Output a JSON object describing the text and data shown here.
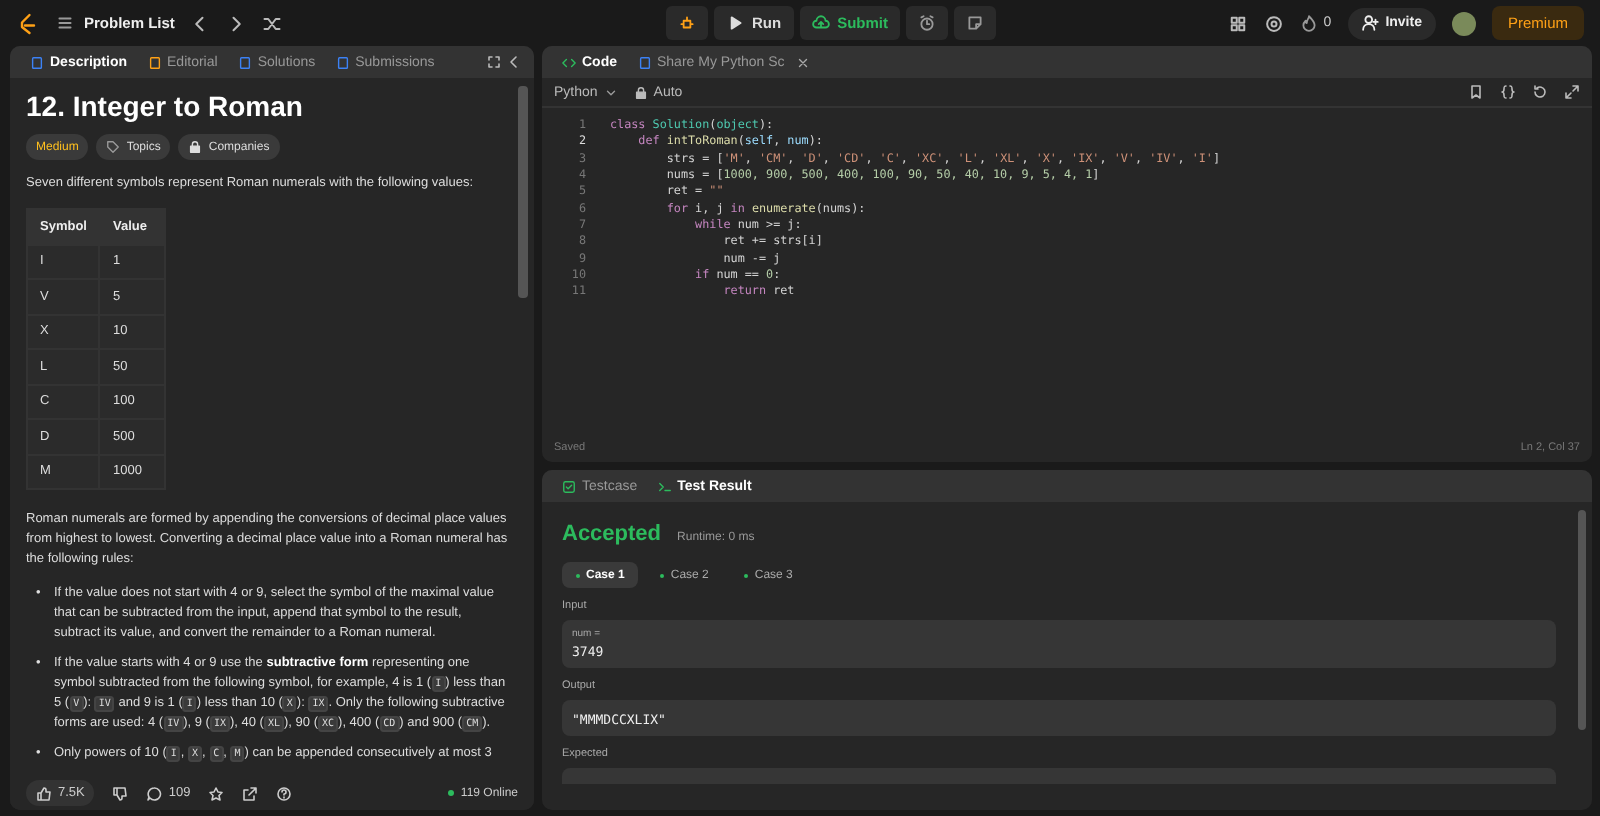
{
  "topbar": {
    "nav_title": "Problem List",
    "run": "Run",
    "submit": "Submit",
    "streak": "0",
    "invite": "Invite",
    "premium": "Premium"
  },
  "left_tabs": [
    {
      "label": "Description",
      "selected": true
    },
    {
      "label": "Editorial",
      "selected": false
    },
    {
      "label": "Solutions",
      "selected": false
    },
    {
      "label": "Submissions",
      "selected": false
    }
  ],
  "problem": {
    "title": "12. Integer to Roman",
    "difficulty": "Medium",
    "tags": [
      "Topics",
      "Companies"
    ],
    "intro": "Seven different symbols represent Roman numerals with the following values:",
    "table": {
      "columns": [
        "Symbol",
        "Value"
      ],
      "rows": [
        [
          "I",
          "1"
        ],
        [
          "V",
          "5"
        ],
        [
          "X",
          "10"
        ],
        [
          "L",
          "50"
        ],
        [
          "C",
          "100"
        ],
        [
          "D",
          "500"
        ],
        [
          "M",
          "1000"
        ]
      ]
    },
    "paragraph": "Roman numerals are formed by appending the conversions of decimal place values from highest to lowest. Converting a decimal place value into a Roman numeral has the following rules:",
    "rules": [
      {
        "marker": "•",
        "segments": [
          {
            "kind": "text",
            "text": "If the value does not start with 4 or 9, select the symbol of the maximal value that can be subtracted from the input, append that symbol to the result, subtract its value, and convert the remainder to a Roman numeral."
          }
        ]
      },
      {
        "marker": "•",
        "segments": [
          {
            "kind": "text",
            "text": "If the value starts with 4 or 9 use the "
          },
          {
            "kind": "bold",
            "text": "subtractive form"
          },
          {
            "kind": "text",
            "text": " representing one symbol subtracted from the following symbol, for example, 4 is 1 ("
          },
          {
            "kind": "code",
            "text": "I"
          },
          {
            "kind": "text",
            "text": ") less than 5 ("
          },
          {
            "kind": "code",
            "text": "V"
          },
          {
            "kind": "text",
            "text": "): "
          },
          {
            "kind": "code",
            "text": "IV"
          },
          {
            "kind": "text",
            "text": " and 9 is 1 ("
          },
          {
            "kind": "code",
            "text": "I"
          },
          {
            "kind": "text",
            "text": ") less than 10 ("
          },
          {
            "kind": "code",
            "text": "X"
          },
          {
            "kind": "text",
            "text": "): "
          },
          {
            "kind": "code",
            "text": "IX"
          },
          {
            "kind": "text",
            "text": ". Only the following subtractive forms are used: 4 ("
          },
          {
            "kind": "code",
            "text": "IV"
          },
          {
            "kind": "text",
            "text": "), 9 ("
          },
          {
            "kind": "code",
            "text": "IX"
          },
          {
            "kind": "text",
            "text": "), 40 ("
          },
          {
            "kind": "code",
            "text": "XL"
          },
          {
            "kind": "text",
            "text": "), 90 ("
          },
          {
            "kind": "code",
            "text": "XC"
          },
          {
            "kind": "text",
            "text": "), 400 ("
          },
          {
            "kind": "code",
            "text": "CD"
          },
          {
            "kind": "text",
            "text": ") and 900 ("
          },
          {
            "kind": "code",
            "text": "CM"
          },
          {
            "kind": "text",
            "text": ")."
          }
        ]
      },
      {
        "marker": "•",
        "segments": [
          {
            "kind": "text",
            "text": "Only powers of 10 ("
          },
          {
            "kind": "code",
            "text": "I"
          },
          {
            "kind": "text",
            "text": ", "
          },
          {
            "kind": "code",
            "text": "X"
          },
          {
            "kind": "text",
            "text": ", "
          },
          {
            "kind": "code",
            "text": "C"
          },
          {
            "kind": "text",
            "text": ", "
          },
          {
            "kind": "code",
            "text": "M"
          },
          {
            "kind": "text",
            "text": ") can be appended consecutively at most 3"
          }
        ]
      }
    ]
  },
  "footer": {
    "likes": "7.5K",
    "comments": "109",
    "online": "119 Online"
  },
  "code_tabs": [
    {
      "label": "Code",
      "selected": true
    },
    {
      "label": "Share My Python Sc",
      "selected": false
    }
  ],
  "editor": {
    "language": "Python",
    "mode": "Auto",
    "status": "Saved",
    "cursor": "Ln 2, Col 37",
    "lines": [
      {
        "number": "1",
        "active": false,
        "tokens": [
          {
            "kind": "kw",
            "text": "class "
          },
          {
            "kind": "type",
            "text": "Solution"
          },
          {
            "kind": "plain",
            "text": "("
          },
          {
            "kind": "type",
            "text": "object"
          },
          {
            "kind": "plain",
            "text": "):"
          }
        ]
      },
      {
        "number": "2",
        "active": true,
        "tokens": [
          {
            "kind": "kw",
            "text": "    def "
          },
          {
            "kind": "fn",
            "text": "intToRoman"
          },
          {
            "kind": "plain",
            "text": "("
          },
          {
            "kind": "var",
            "text": "self"
          },
          {
            "kind": "plain",
            "text": ", "
          },
          {
            "kind": "var",
            "text": "num"
          },
          {
            "kind": "plain",
            "text": "):"
          }
        ]
      },
      {
        "number": "3",
        "active": false,
        "tokens": [
          {
            "kind": "plain",
            "text": "        strs = ["
          },
          {
            "kind": "str",
            "text": "'M'"
          },
          {
            "kind": "plain",
            "text": ", "
          },
          {
            "kind": "str",
            "text": "'CM'"
          },
          {
            "kind": "plain",
            "text": ", "
          },
          {
            "kind": "str",
            "text": "'D'"
          },
          {
            "kind": "plain",
            "text": ", "
          },
          {
            "kind": "str",
            "text": "'CD'"
          },
          {
            "kind": "plain",
            "text": ", "
          },
          {
            "kind": "str",
            "text": "'C'"
          },
          {
            "kind": "plain",
            "text": ", "
          },
          {
            "kind": "str",
            "text": "'XC'"
          },
          {
            "kind": "plain",
            "text": ", "
          },
          {
            "kind": "str",
            "text": "'L'"
          },
          {
            "kind": "plain",
            "text": ", "
          },
          {
            "kind": "str",
            "text": "'XL'"
          },
          {
            "kind": "plain",
            "text": ", "
          },
          {
            "kind": "str",
            "text": "'X'"
          },
          {
            "kind": "plain",
            "text": ", "
          },
          {
            "kind": "str",
            "text": "'IX'"
          },
          {
            "kind": "plain",
            "text": ", "
          },
          {
            "kind": "str",
            "text": "'V'"
          },
          {
            "kind": "plain",
            "text": ", "
          },
          {
            "kind": "str",
            "text": "'IV'"
          },
          {
            "kind": "plain",
            "text": ", "
          },
          {
            "kind": "str",
            "text": "'I'"
          },
          {
            "kind": "plain",
            "text": "]"
          }
        ]
      },
      {
        "number": "4",
        "active": false,
        "tokens": [
          {
            "kind": "plain",
            "text": "        nums = ["
          },
          {
            "kind": "num",
            "text": "1000, 900, 500, 400, 100, 90, 50, 40, 10, 9, 5, 4, 1"
          },
          {
            "kind": "plain",
            "text": "]"
          }
        ]
      },
      {
        "number": "5",
        "active": false,
        "tokens": [
          {
            "kind": "plain",
            "text": "        ret = "
          },
          {
            "kind": "str",
            "text": "\"\""
          }
        ]
      },
      {
        "number": "6",
        "active": false,
        "tokens": [
          {
            "kind": "kw",
            "text": "        for"
          },
          {
            "kind": "plain",
            "text": " i, j "
          },
          {
            "kind": "kw",
            "text": "in "
          },
          {
            "kind": "fn",
            "text": "enumerate"
          },
          {
            "kind": "plain",
            "text": "(nums):"
          }
        ]
      },
      {
        "number": "7",
        "active": false,
        "tokens": [
          {
            "kind": "kw",
            "text": "            while"
          },
          {
            "kind": "plain",
            "text": " num >= j:"
          }
        ]
      },
      {
        "number": "8",
        "active": false,
        "tokens": [
          {
            "kind": "plain",
            "text": "                ret += strs[i]"
          }
        ]
      },
      {
        "number": "9",
        "active": false,
        "tokens": [
          {
            "kind": "plain",
            "text": "                num -= j"
          }
        ]
      },
      {
        "number": "10",
        "active": false,
        "tokens": [
          {
            "kind": "kw",
            "text": "            if"
          },
          {
            "kind": "plain",
            "text": " num == "
          },
          {
            "kind": "num",
            "text": "0"
          },
          {
            "kind": "plain",
            "text": ":"
          }
        ]
      },
      {
        "number": "11",
        "active": false,
        "tokens": [
          {
            "kind": "kw",
            "text": "                return"
          },
          {
            "kind": "plain",
            "text": " ret"
          }
        ]
      }
    ]
  },
  "result_tabs": [
    {
      "label": "Testcase",
      "selected": false
    },
    {
      "label": "Test Result",
      "selected": true
    }
  ],
  "result": {
    "status": "Accepted",
    "runtime": "Runtime: 0 ms",
    "cases": [
      {
        "label": "Case 1",
        "selected": true,
        "passed": true
      },
      {
        "label": "Case 2",
        "selected": false,
        "passed": true
      },
      {
        "label": "Case 3",
        "selected": false,
        "passed": true
      }
    ],
    "input_label": "Input",
    "input_name": "num =",
    "input_value": "3749",
    "output_label": "Output",
    "output_value": "\"MMMDCCXLIX\"",
    "expected_label": "Expected"
  }
}
